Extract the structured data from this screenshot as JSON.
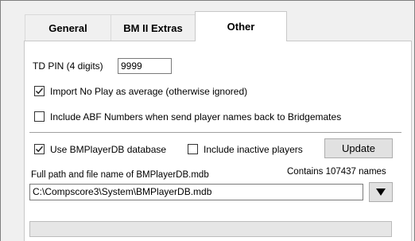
{
  "tabs": [
    {
      "label": "General"
    },
    {
      "label": "BM II Extras"
    },
    {
      "label": "Other"
    }
  ],
  "td_pin": {
    "label": "TD PIN (4 digits)",
    "value": "9999"
  },
  "options": {
    "import_no_play": {
      "label": "Import No Play as average (otherwise ignored)",
      "checked": true
    },
    "include_abf": {
      "label": "Include ABF Numbers when send player names back to Bridgemates",
      "checked": false
    },
    "use_bmplayerdb": {
      "label": "Use BMPlayerDB database",
      "checked": true
    },
    "include_inactive": {
      "label": "Include inactive players",
      "checked": false
    }
  },
  "update_button": {
    "label": "Update"
  },
  "db_path": {
    "label": "Full path and file name of BMPlayerDB.mdb",
    "contains": "Contains 107437 names",
    "value": "C:\\Compscore3\\System\\BMPlayerDB.mdb"
  },
  "icons": {
    "dropdown": "triangle-down-icon",
    "checkmark": "checkmark-icon"
  },
  "progress": {
    "value": 0
  }
}
